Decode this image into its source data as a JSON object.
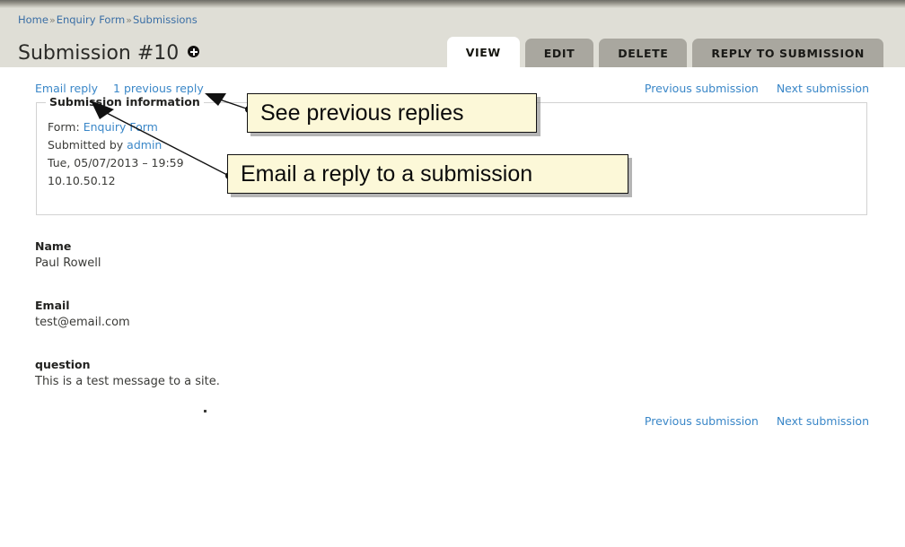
{
  "header": {
    "breadcrumb": [
      {
        "label": "Home"
      },
      {
        "label": "Enquiry Form"
      },
      {
        "label": "Submissions"
      }
    ],
    "breadcrumb_separator": "»",
    "page_title": "Submission #10",
    "config_icon": "cog-icon",
    "tabs": [
      {
        "label": "VIEW",
        "active": true
      },
      {
        "label": "EDIT",
        "active": false
      },
      {
        "label": "DELETE",
        "active": false
      },
      {
        "label": "REPLY TO SUBMISSION",
        "active": false
      }
    ]
  },
  "actions": {
    "email_reply": "Email reply",
    "previous_reply": "1 previous reply"
  },
  "navigation": {
    "previous_submission": "Previous submission",
    "next_submission": "Next submission"
  },
  "submission_information": {
    "legend": "Submission information",
    "form_label": "Form:",
    "form_name": "Enquiry Form",
    "submitted_by_label": "Submitted by",
    "submitted_by_user": "admin",
    "submitted_date": "Tue, 05/07/2013 – 19:59",
    "ip_address": "10.10.50.12"
  },
  "fields": [
    {
      "label": "Name",
      "value": "Paul Rowell"
    },
    {
      "label": "Email",
      "value": "test@email.com"
    },
    {
      "label": "question",
      "value": "This is a test message to a site."
    }
  ],
  "annotations": [
    {
      "text": "See previous replies"
    },
    {
      "text": "Email a reply to a submission"
    }
  ],
  "colors": {
    "header_background": "#dfded6",
    "tab_inactive": "#a9a79f",
    "tab_active": "#ffffff",
    "link_blue": "#3a87c8",
    "breadcrumb_blue": "#3a6ea5",
    "callout_background": "#fcf8d8",
    "callout_border": "#111111"
  }
}
